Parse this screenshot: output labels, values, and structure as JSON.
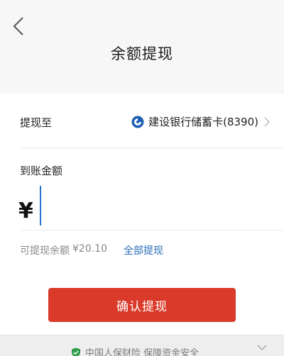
{
  "header": {
    "title": "余额提现",
    "back_icon": "chevron-left-icon"
  },
  "withdraw_to": {
    "label": "提现至",
    "bank_name": "建设银行储蓄卡(8390)",
    "bank_icon": "bank-logo-icon",
    "chevron_icon": "chevron-right-icon"
  },
  "amount": {
    "label": "到账金额",
    "currency_symbol": "¥",
    "value": "",
    "placeholder": ""
  },
  "balance": {
    "label": "可提现余额",
    "value": "¥20.10",
    "withdraw_all_label": "全部提现"
  },
  "confirm": {
    "label": "确认提现"
  },
  "footer": {
    "text": "中国人保财险 保障资金安全",
    "shield_icon": "shield-check-icon",
    "colors": {
      "shield": "#2e9d4a"
    }
  },
  "colors": {
    "primary_button": "#d93a2a",
    "link": "#2a6db8",
    "caret": "#2b6fd6"
  }
}
